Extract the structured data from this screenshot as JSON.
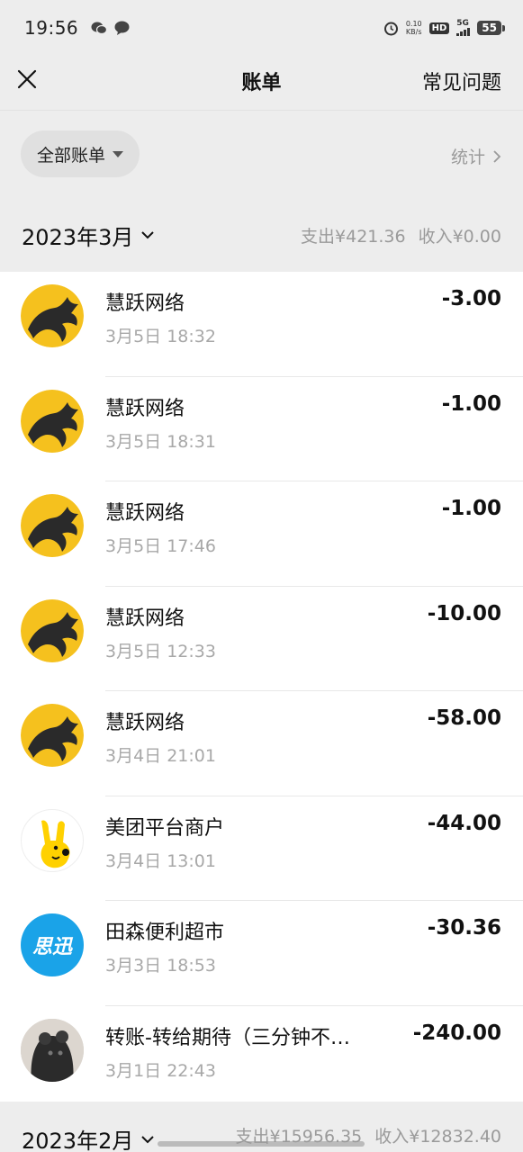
{
  "status": {
    "time": "19:56",
    "netspeed_value": "0.10",
    "netspeed_unit": "KB/s",
    "hd": "HD",
    "network": "5G",
    "battery": "55"
  },
  "nav": {
    "title": "账单",
    "faq": "常见问题"
  },
  "filter": {
    "chip_label": "全部账单",
    "stats_label": "统计"
  },
  "months": [
    {
      "label": "2023年3月",
      "expense": "支出¥421.36",
      "income": "收入¥0.00"
    },
    {
      "label": "2023年2月",
      "expense": "支出¥15956.35",
      "income": "收入¥12832.40"
    }
  ],
  "transactions": [
    {
      "name": "慧跃网络",
      "time": "3月5日 18:32",
      "amount": "-3.00",
      "avatar": "dragon-logo"
    },
    {
      "name": "慧跃网络",
      "time": "3月5日 18:31",
      "amount": "-1.00",
      "avatar": "dragon-logo"
    },
    {
      "name": "慧跃网络",
      "time": "3月5日 17:46",
      "amount": "-1.00",
      "avatar": "dragon-logo"
    },
    {
      "name": "慧跃网络",
      "time": "3月5日 12:33",
      "amount": "-10.00",
      "avatar": "dragon-logo"
    },
    {
      "name": "慧跃网络",
      "time": "3月4日 21:01",
      "amount": "-58.00",
      "avatar": "dragon-logo"
    },
    {
      "name": "美团平台商户",
      "time": "3月4日 13:01",
      "amount": "-44.00",
      "avatar": "meituan-kangaroo"
    },
    {
      "name": "田森便利超市",
      "time": "3月3日 18:53",
      "amount": "-30.36",
      "avatar": "sixun-logo",
      "avatar_text": "思迅"
    },
    {
      "name": "转账-转给期待（三分钟不…",
      "time": "3月1日 22:43",
      "amount": "-240.00",
      "avatar": "pet-photo"
    }
  ],
  "colors": {
    "background": "#ededed",
    "dragon_yellow": "#f5c11e",
    "sixun_blue": "#1aa3e8",
    "meituan_yellow": "#ffd100"
  }
}
